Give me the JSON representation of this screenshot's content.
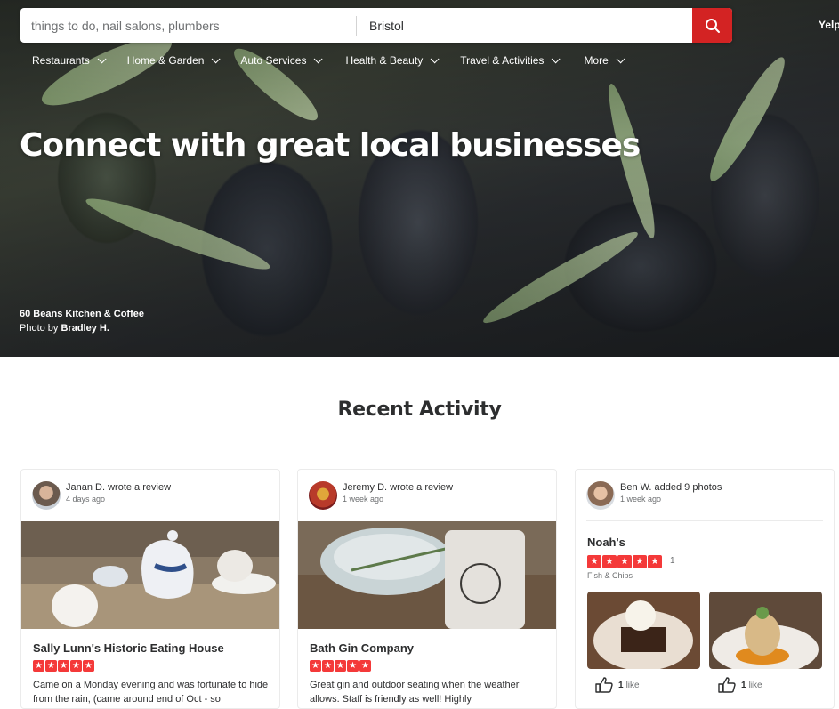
{
  "search": {
    "find_placeholder": "things to do, nail salons, plumbers",
    "near_value": "Bristol"
  },
  "header": {
    "yelp_link": "Yelp"
  },
  "nav": [
    {
      "label": "Restaurants"
    },
    {
      "label": "Home & Garden"
    },
    {
      "label": "Auto Services"
    },
    {
      "label": "Health & Beauty"
    },
    {
      "label": "Travel & Activities"
    },
    {
      "label": "More"
    }
  ],
  "hero": {
    "title": "Connect with great local businesses",
    "credit_business": "60 Beans Kitchen & Coffee",
    "credit_prefix": "Photo by",
    "credit_author": "Bradley H."
  },
  "section": {
    "title": "Recent Activity"
  },
  "colors": {
    "brand_red": "#d32323",
    "star_red": "#f43939"
  },
  "cards": [
    {
      "user": "Janan D.",
      "action": "wrote a review",
      "time": "4 days ago",
      "business": "Sally Lunn's Historic Eating House",
      "rating": 5,
      "text": "Came on a Monday evening and was fortunate to hide from the rain, (came around end of Oct - so"
    },
    {
      "user": "Jeremy D.",
      "action": "wrote a review",
      "time": "1 week ago",
      "business": "Bath Gin Company",
      "rating": 5,
      "text": "Great gin and outdoor seating when the weather allows. Staff is friendly as well! Highly"
    },
    {
      "user": "Ben W.",
      "action": "added 9 photos",
      "time": "1 week ago",
      "business": "Noah's",
      "rating": 5,
      "review_count": "1",
      "category": "Fish & Chips",
      "likes": [
        {
          "count": "1",
          "label": "like"
        },
        {
          "count": "1",
          "label": "like"
        }
      ]
    }
  ]
}
